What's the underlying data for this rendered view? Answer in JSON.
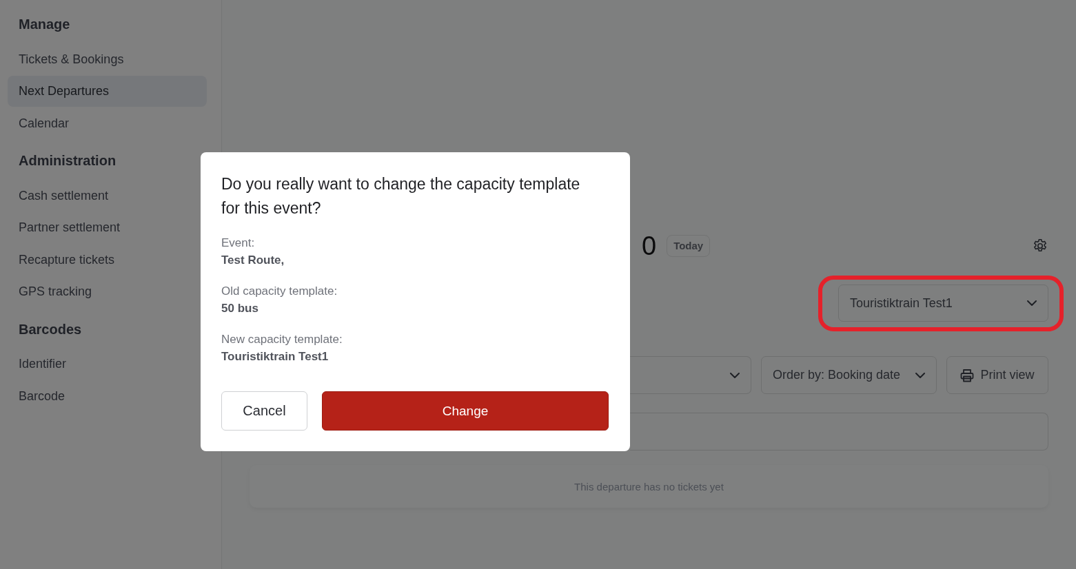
{
  "sidebar": {
    "sections": [
      {
        "title": "Manage",
        "items": [
          {
            "label": "Tickets & Bookings",
            "selected": false
          },
          {
            "label": "Next Departures",
            "selected": true
          },
          {
            "label": "Calendar",
            "selected": false
          }
        ]
      },
      {
        "title": "Administration",
        "items": [
          {
            "label": "Cash settlement",
            "selected": false
          },
          {
            "label": "Partner settlement",
            "selected": false
          },
          {
            "label": "Recapture tickets",
            "selected": false
          },
          {
            "label": "GPS tracking",
            "selected": false
          }
        ]
      },
      {
        "title": "Barcodes",
        "items": [
          {
            "label": "Identifier",
            "selected": false
          },
          {
            "label": "Barcode",
            "selected": false
          }
        ]
      }
    ]
  },
  "departure": {
    "heading_fragment": "0",
    "badge": "Today",
    "capacity_select": {
      "value": "Touristiktrain Test1",
      "highlighted": true
    },
    "filters": [
      {
        "kind": "select"
      },
      {
        "kind": "select",
        "label": "Order by: Booking date"
      },
      {
        "kind": "button",
        "label": "Print view"
      }
    ],
    "empty_message": "This departure has no tickets yet"
  },
  "dialog": {
    "title": "Do you really want to change the capacity template for this event?",
    "details": [
      {
        "label": "Event:",
        "value": "Test Route,"
      },
      {
        "label": "Old capacity template:",
        "value": "50 bus"
      },
      {
        "label": "New capacity template:",
        "value": "Touristiktrain Test1"
      }
    ],
    "buttons": [
      {
        "label": "Cancel",
        "kind": "secondary"
      },
      {
        "label": "Change",
        "kind": "primary"
      }
    ]
  }
}
